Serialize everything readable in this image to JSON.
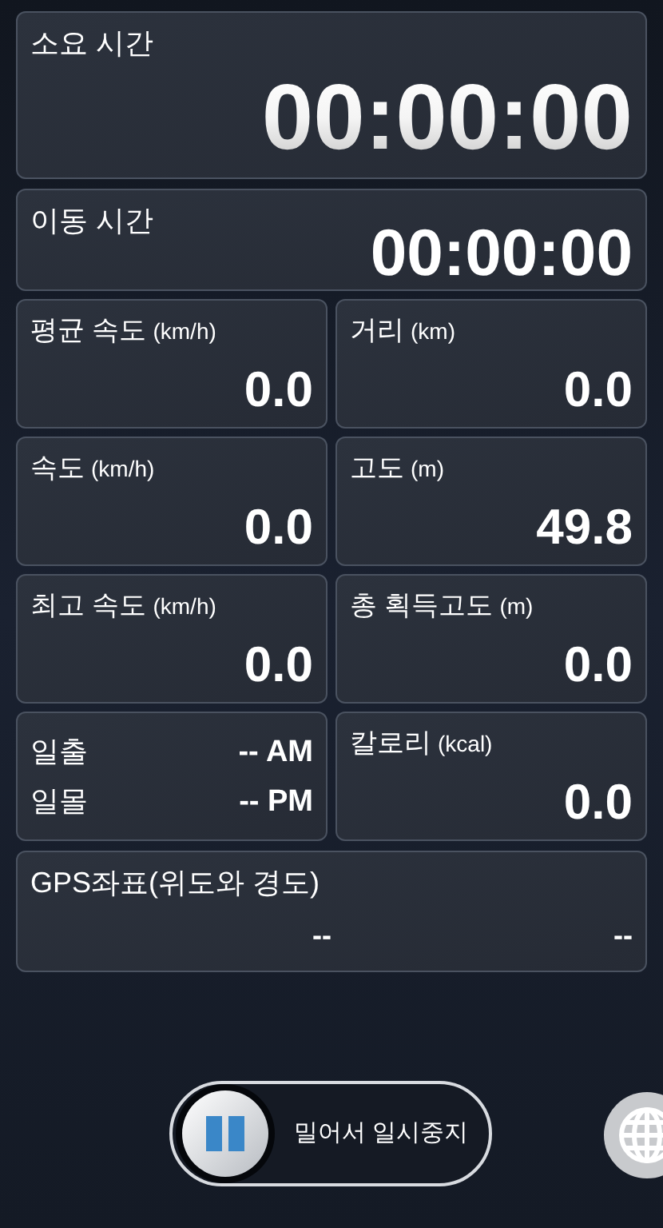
{
  "elapsed_time": {
    "label": "소요 시간",
    "value": "00:00:00"
  },
  "moving_time": {
    "label": "이동 시간",
    "value": "00:00:00"
  },
  "stats": [
    {
      "kind": "stat",
      "label": "평균 속도",
      "unit": "(km/h)",
      "value": "0.0"
    },
    {
      "kind": "stat",
      "label": "거리",
      "unit": "(km)",
      "value": "0.0"
    },
    {
      "kind": "stat",
      "label": "속도",
      "unit": "(km/h)",
      "value": "0.0"
    },
    {
      "kind": "stat",
      "label": "고도",
      "unit": "(m)",
      "value": "49.8"
    },
    {
      "kind": "stat",
      "label": "최고 속도",
      "unit": "(km/h)",
      "value": "0.0"
    },
    {
      "kind": "stat",
      "label": "총 획득고도",
      "unit": "(m)",
      "value": "0.0"
    },
    {
      "kind": "sun",
      "rows": [
        {
          "label": "일출",
          "value": "-- AM"
        },
        {
          "label": "일몰",
          "value": "-- PM"
        }
      ]
    },
    {
      "kind": "stat",
      "label": "칼로리",
      "unit": "(kcal)",
      "value": "0.0"
    }
  ],
  "gps": {
    "label": "GPS좌표(위도와 경도)",
    "latitude": "--",
    "longitude": "--"
  },
  "pause_slider": {
    "label": "밀어서 일시중지"
  }
}
